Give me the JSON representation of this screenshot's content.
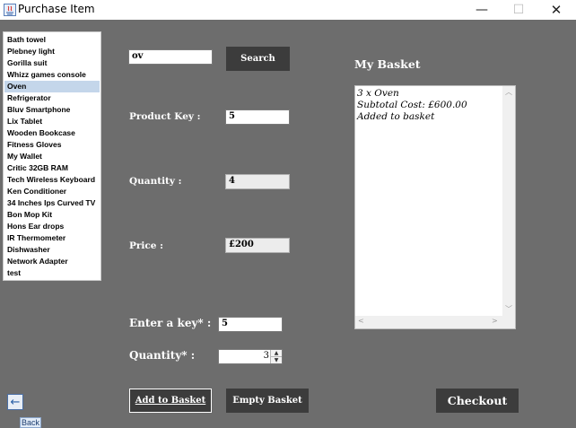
{
  "window": {
    "title": "Purchase Item",
    "minimize_glyph": "—",
    "maximize_glyph": "☐",
    "close_glyph": "✕"
  },
  "products": [
    "Bath towel",
    "Plebney light",
    "Gorilla suit",
    "Whizz games console",
    "Oven",
    "Refrigerator",
    "Bluv Smartphone",
    "Lix Tablet",
    "Wooden Bookcase",
    "Fitness Gloves",
    "My Wallet",
    "Critic 32GB RAM",
    "Tech Wireless Keyboard",
    "Ken Conditioner",
    "34 Inches Ips Curved TV",
    "Bon Mop Kit",
    "Hons Ear drops",
    "IR Thermometer",
    "Dishwasher",
    "Network Adapter",
    "test"
  ],
  "selected_product": "Oven",
  "search": {
    "value": "ov",
    "button_label": "Search"
  },
  "details": {
    "product_key_label": "Product Key :",
    "product_key_value": "5",
    "quantity_label": "Quantity :",
    "quantity_value": "4",
    "price_label": "Price :",
    "price_value": "£200"
  },
  "entry": {
    "key_label": "Enter a key* :",
    "key_value": "5",
    "quantity_label": "Quantity* :",
    "quantity_value": "3"
  },
  "actions": {
    "add_label": "Add to Basket",
    "empty_label": "Empty Basket",
    "checkout_label": "Checkout"
  },
  "basket": {
    "title": "My Basket",
    "lines": [
      "3 x Oven",
      "Subtotal Cost: £600.00",
      "Added to basket"
    ]
  },
  "back": {
    "label": "Back"
  },
  "colors": {
    "background": "#6d6d6d",
    "button": "#3c3c3c",
    "selection": "#c4d6ea"
  }
}
